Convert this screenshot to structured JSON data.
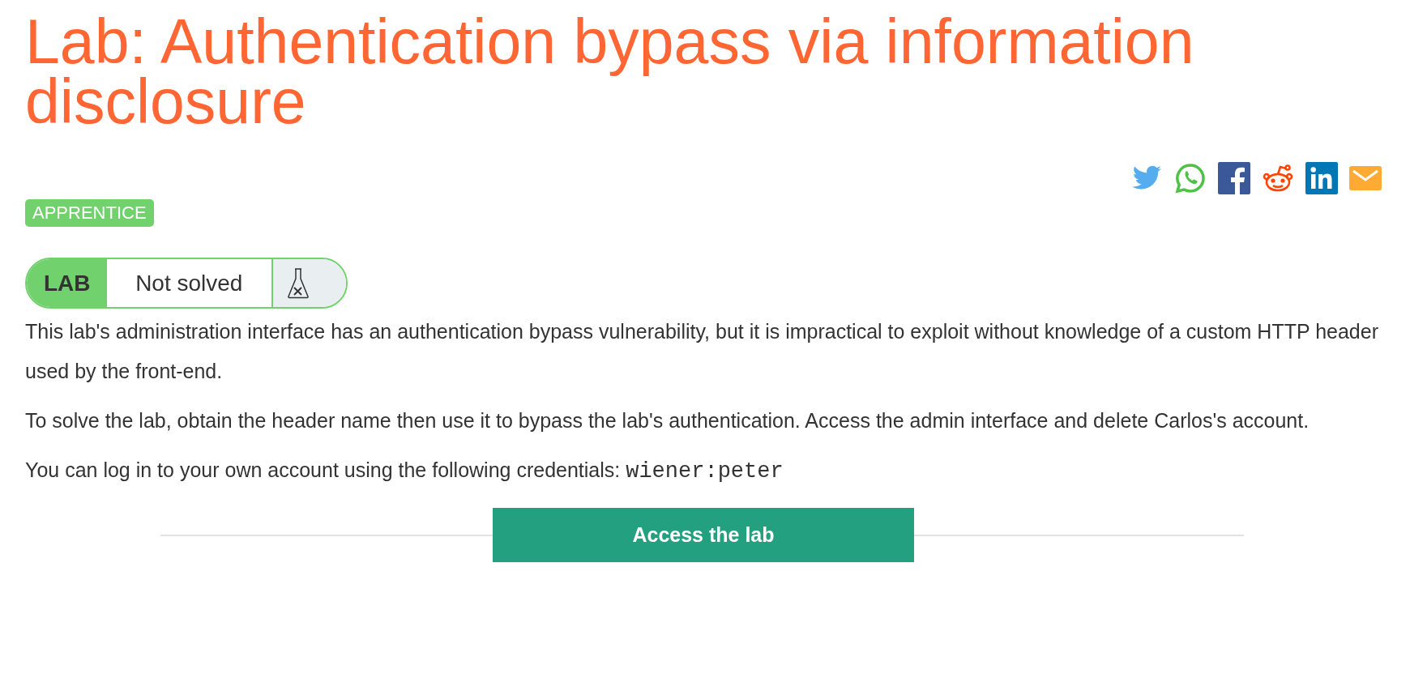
{
  "title": "Lab: Authentication bypass via information disclosure",
  "share_icons": [
    {
      "kind": "twitter"
    },
    {
      "kind": "whatsapp"
    },
    {
      "kind": "facebook"
    },
    {
      "kind": "reddit"
    },
    {
      "kind": "linkedin"
    },
    {
      "kind": "email"
    }
  ],
  "level_badge": "APPRENTICE",
  "lab_status": {
    "label": "LAB",
    "status": "Not solved",
    "solved": false
  },
  "paragraphs": [
    "This lab's administration interface has an authentication bypass vulnerability, but it is impractical to exploit without knowledge of a custom HTTP header used by the front-end.",
    "To solve the lab, obtain the header name then use it to bypass the lab's authentication. Access the admin interface and delete Carlos's account."
  ],
  "credentials": {
    "text": "You can log in to your own account using the following credentials:",
    "code": "wiener:peter"
  },
  "access_button": "Access the lab"
}
